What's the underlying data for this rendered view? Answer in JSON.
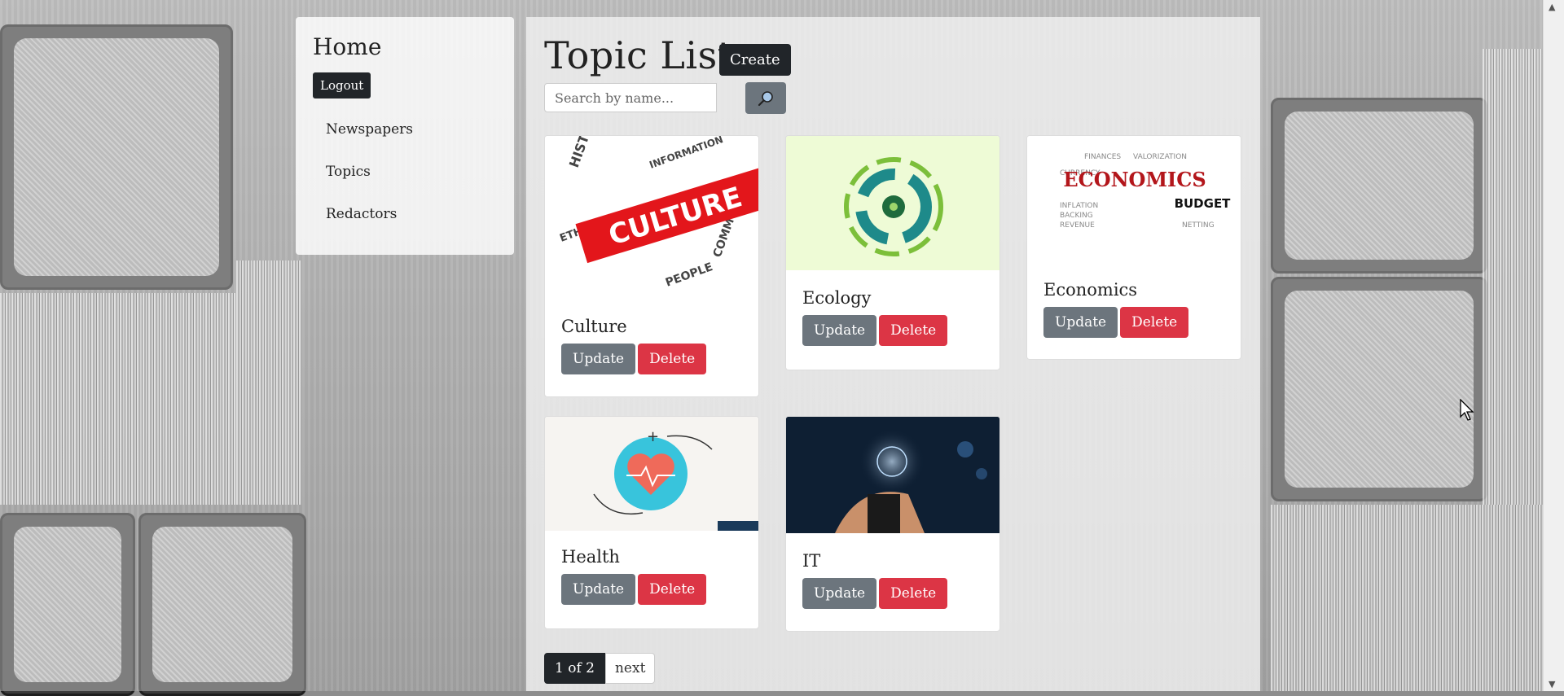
{
  "sidebar": {
    "title": "Home",
    "logout_label": "Logout",
    "nav_items": [
      {
        "label": "Newspapers"
      },
      {
        "label": "Topics"
      },
      {
        "label": "Redactors"
      }
    ]
  },
  "main": {
    "title": "Topic List",
    "create_label": "Create",
    "search": {
      "placeholder": "Search by name...",
      "value": ""
    }
  },
  "topics": [
    {
      "name": "Culture",
      "image_text": "CULTURE",
      "update_label": "Update",
      "delete_label": "Delete"
    },
    {
      "name": "Ecology",
      "update_label": "Update",
      "delete_label": "Delete"
    },
    {
      "name": "Economics",
      "image_text": "ECONOMICS",
      "image_subtext": "BUDGET",
      "update_label": "Update",
      "delete_label": "Delete"
    },
    {
      "name": "Health",
      "update_label": "Update",
      "delete_label": "Delete"
    },
    {
      "name": "IT",
      "update_label": "Update",
      "delete_label": "Delete"
    }
  ],
  "pagination": {
    "current": "1 of 2",
    "next_label": "next"
  },
  "colors": {
    "primary_dark": "#212529",
    "secondary": "#6c757d",
    "danger": "#dc3545",
    "ecology_bg": "#eefbd6",
    "it_bg": "#0e1f33"
  },
  "icons": {
    "search": "magnifier-icon",
    "cursor": "mouse-pointer-icon"
  }
}
